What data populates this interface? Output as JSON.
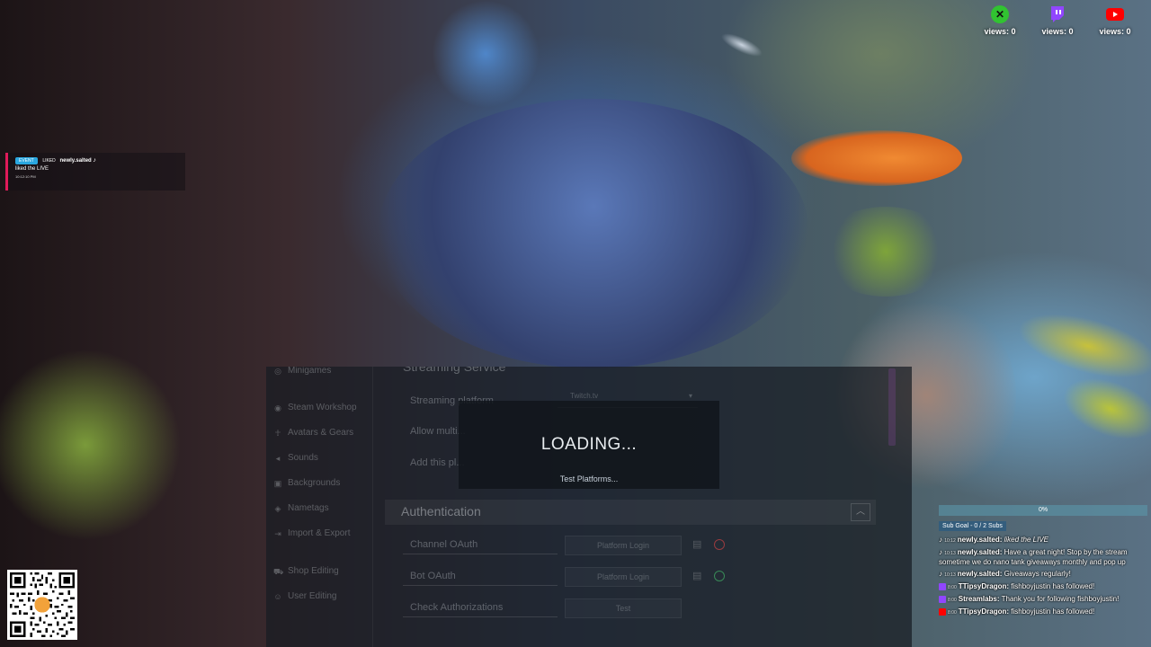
{
  "platform_views": [
    {
      "platform": "xbox",
      "icon": "xbox-icon",
      "color": "#31c331",
      "label": "views: 0"
    },
    {
      "platform": "twitch",
      "icon": "twitch-icon",
      "color": "#9146ff",
      "label": "views: 0"
    },
    {
      "platform": "youtube",
      "icon": "youtube-icon",
      "color": "#ff0000",
      "label": "views: 0"
    }
  ],
  "notification": {
    "badge": "EVENT",
    "tag": "LIKED",
    "username": "newly.salted",
    "text": "liked the LIVE",
    "time": "10:12:10 PM",
    "accent": "#e01b5a"
  },
  "settings_window": {
    "sidebar": [
      {
        "label": "Minigames",
        "icon": "gamepad-icon"
      },
      {
        "label": "Steam Workshop",
        "icon": "steam-icon"
      },
      {
        "label": "Avatars & Gears",
        "icon": "avatar-icon"
      },
      {
        "label": "Sounds",
        "icon": "speaker-icon"
      },
      {
        "label": "Backgrounds",
        "icon": "image-icon"
      },
      {
        "label": "Nametags",
        "icon": "tag-icon"
      },
      {
        "label": "Import & Export",
        "icon": "import-export-icon"
      },
      {
        "label": "Shop Editing",
        "icon": "shop-icon"
      },
      {
        "label": "User Editing",
        "icon": "user-icon"
      }
    ],
    "streaming_section_title": "Streaming Service",
    "streaming_rows": [
      {
        "label": "Streaming platform",
        "value": "Twitch.tv"
      },
      {
        "label": "Allow multi...",
        "value": ""
      },
      {
        "label": "Add this pl...",
        "value": ""
      }
    ],
    "auth_title": "Authentication",
    "auth_rows": [
      {
        "label": "Channel OAuth",
        "button": "Platform Login",
        "status": "error"
      },
      {
        "label": "Bot OAuth",
        "button": "Platform Login",
        "status": "ok"
      },
      {
        "label": "Check Authorizations",
        "button": "Test",
        "status": ""
      }
    ]
  },
  "loading": {
    "title": "LOADING...",
    "subtitle": "Test Platforms..."
  },
  "sub_goal": {
    "percent_label": "0%",
    "progress": 0,
    "label": "Sub Goal - 0 / 2 Subs"
  },
  "chat": [
    {
      "platform_color": "#ffffff",
      "time": "10:12",
      "user": "newly.salted:",
      "text": " liked the LIVE",
      "italic": true
    },
    {
      "platform_color": "#ffffff",
      "time": "10:13",
      "user": "newly.salted:",
      "text": " Have a great night! Stop by the stream sometime we do nano tank giveaways monthly and pop up"
    },
    {
      "platform_color": "#ffffff",
      "time": "10:13",
      "user": "newly.salted:",
      "text": " Giveaways regularly!"
    },
    {
      "platform_color": "#9146ff",
      "time": "8:00",
      "user": "TTipsyDragon:",
      "text": " fishboyjustin has followed!"
    },
    {
      "platform_color": "#9146ff",
      "time": "8:00",
      "user": "Streamlabs:",
      "text": " Thank you for following fishboyjustin!"
    },
    {
      "platform_color": "#ff0000",
      "time": "8:00",
      "user": "TTipsyDragon:",
      "text": " fishboyjustin has followed!"
    }
  ]
}
